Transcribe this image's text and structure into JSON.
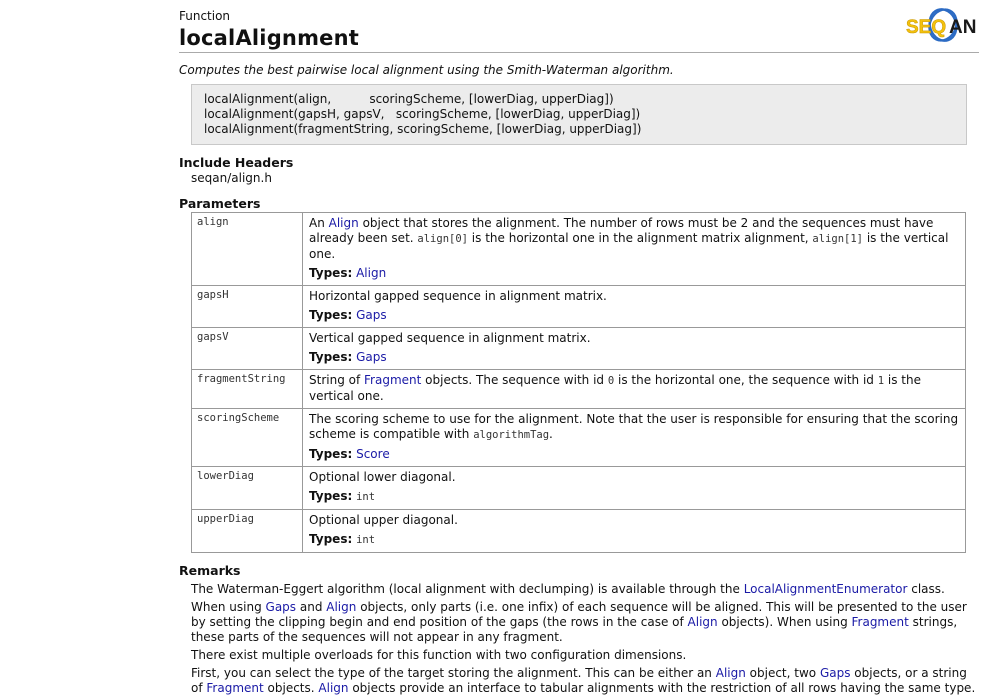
{
  "header": {
    "kind": "Function",
    "title": "localAlignment",
    "logo_text": "SEQAN"
  },
  "summary": "Computes the best pairwise local alignment using the Smith-Waterman algorithm.",
  "signatures": [
    "localAlignment(align,          scoringScheme, [lowerDiag, upperDiag])",
    "localAlignment(gapsH, gapsV,   scoringScheme, [lowerDiag, upperDiag])",
    "localAlignment(fragmentString, scoringScheme, [lowerDiag, upperDiag])"
  ],
  "include": {
    "heading": "Include Headers",
    "file": "seqan/align.h"
  },
  "params": {
    "heading": "Parameters",
    "types_label": "Types:",
    "rows": [
      {
        "name": "align",
        "d1": "An ",
        "d1_link": "Align",
        "d2": " object that stores the alignment. The number of rows must be 2 and the sequences must have already been set. ",
        "d2_code": "align[0]",
        "d3": " is the horizontal one in the alignment matrix alignment, ",
        "d3_code": "align[1]",
        "d4": " is the vertical one.",
        "type": "Align"
      },
      {
        "name": "gapsH",
        "desc": "Horizontal gapped sequence in alignment matrix.",
        "type": "Gaps"
      },
      {
        "name": "gapsV",
        "desc": "Vertical gapped sequence in alignment matrix.",
        "type": "Gaps"
      },
      {
        "name": "fragmentString",
        "d1": "String of ",
        "d1_link": "Fragment",
        "d2": " objects. The sequence with id ",
        "d2_code": "0",
        "d3": " is the horizontal one, the sequence with id ",
        "d3_code": "1",
        "d4": " is the vertical one."
      },
      {
        "name": "scoringScheme",
        "d1": "The scoring scheme to use for the alignment. Note that the user is responsible for ensuring that the scoring scheme is compatible with ",
        "d1_code": "algorithmTag",
        "d2": ".",
        "type": "Score"
      },
      {
        "name": "lowerDiag",
        "desc": "Optional lower diagonal.",
        "type_code": "int"
      },
      {
        "name": "upperDiag",
        "desc": "Optional upper diagonal.",
        "type_code": "int"
      }
    ]
  },
  "remarks": {
    "heading": "Remarks",
    "p1a": "The Waterman-Eggert algorithm (local alignment with declumping) is available through the ",
    "p1_link": "LocalAlignmentEnumerator",
    "p1b": " class.",
    "p2a": "When using ",
    "p2_link1": "Gaps",
    "p2b": " and ",
    "p2_link2": "Align",
    "p2c": " objects, only parts (i.e. one infix) of each sequence will be aligned. This will be presented to the user by setting the clipping begin and end position of the gaps (the rows in the case of ",
    "p2_link3": "Align",
    "p2d": " objects). When using ",
    "p2_link4": "Fragment",
    "p2e": " strings, these parts of the sequences will not appear in any fragment.",
    "p3": "There exist multiple overloads for this function with two configuration dimensions.",
    "p4a": "First, you can select the type of the target storing the alignment. This can be either an ",
    "p4_link1": "Align",
    "p4b": " object, two ",
    "p4_link2": "Gaps",
    "p4c": " objects, or a string of ",
    "p4_link3": "Fragment",
    "p4d": " objects. ",
    "p4_link4": "Align",
    "p4e": " objects provide an interface to tabular alignments with the restriction of all rows having the same type."
  }
}
